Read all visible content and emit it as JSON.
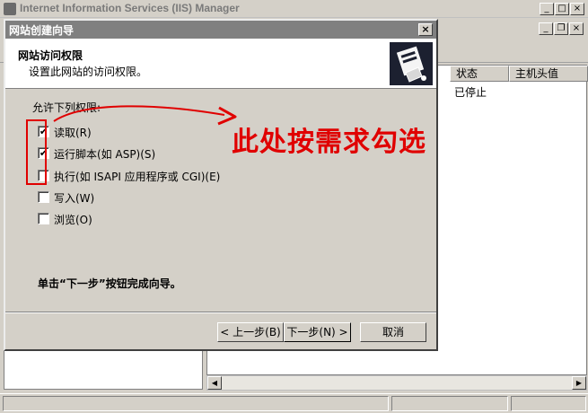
{
  "main_window": {
    "title": "Internet Information Services (IIS) Manager",
    "controls": {
      "minimize": "_",
      "maximize": "□",
      "close": "×"
    },
    "child_controls": {
      "minimize": "_",
      "restore": "❐",
      "close": "×"
    }
  },
  "list_view": {
    "columns": [
      "状态",
      "主机头值"
    ],
    "rows": [
      {
        "status": "已停止"
      }
    ]
  },
  "wizard": {
    "title": "网站创建向导",
    "close_label": "×",
    "header_title": "网站访问权限",
    "header_subtitle": "设置此网站的访问权限。",
    "group_label": "允许下列权限:",
    "options": [
      {
        "label": "读取(R)",
        "checked": true
      },
      {
        "label": "运行脚本(如 ASP)(S)",
        "checked": true
      },
      {
        "label": "执行(如 ISAPI 应用程序或 CGI)(E)",
        "checked": false
      },
      {
        "label": "写入(W)",
        "checked": false
      },
      {
        "label": "浏览(O)",
        "checked": false
      }
    ],
    "check_mark": "✔",
    "finish_hint": "单击“下一步”按钮完成向导。",
    "buttons": {
      "back": "< 上一步(B)",
      "next": "下一步(N) >",
      "cancel": "取消"
    }
  },
  "annotation": {
    "text": "此处按需求勾选",
    "color": "#e00000"
  },
  "scroll": {
    "left": "◀",
    "right": "▶"
  }
}
